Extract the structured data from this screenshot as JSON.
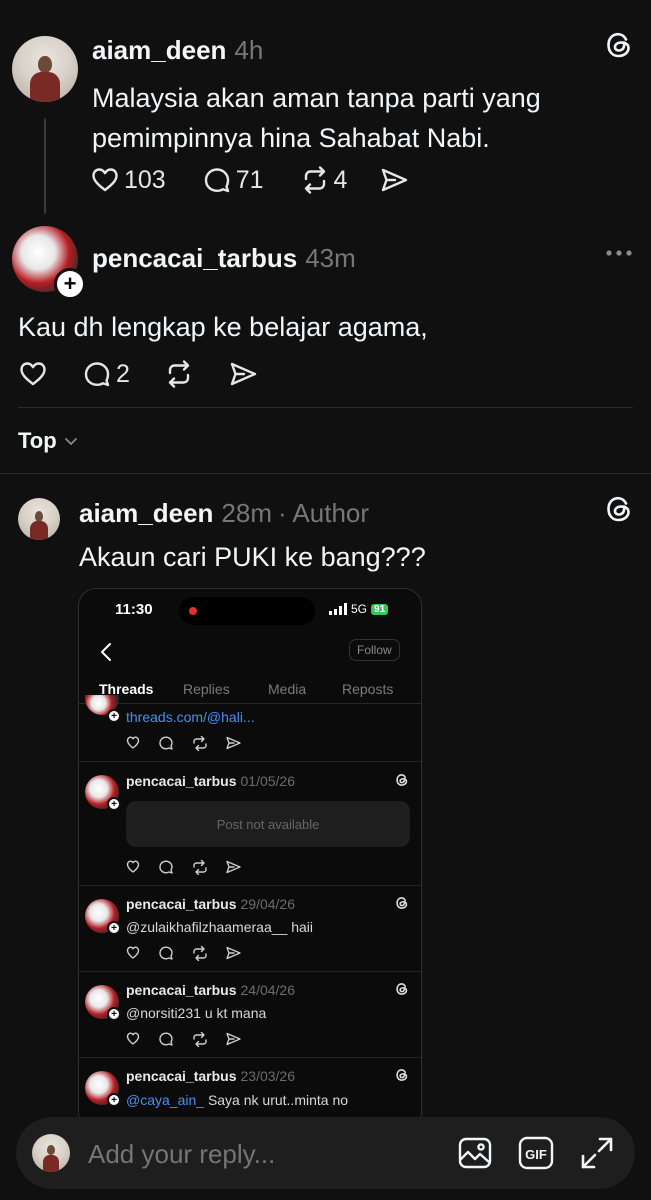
{
  "original_post": {
    "username": "aiam_deen",
    "time": "4h",
    "text_line1": "Malaysia akan aman tanpa parti yang",
    "text_line2": "pemimpinnya hina Sahabat Nabi.",
    "likes": "103",
    "replies": "71",
    "reposts": "4"
  },
  "reply_post": {
    "username": "pencacai_tarbus",
    "time": "43m",
    "text": "Kau dh lengkap ke belajar agama,",
    "replies": "2"
  },
  "sort": {
    "label": "Top"
  },
  "author_reply": {
    "username": "aiam_deen",
    "time": "28m",
    "author_tag": "· Author",
    "text": "Akaun cari PUKI ke bang???"
  },
  "embedded_screenshot": {
    "status_time": "11:30",
    "network": "5G",
    "battery": "91",
    "follow_label": "Follow",
    "tabs": [
      "Threads",
      "Replies",
      "Media",
      "Reposts"
    ],
    "posts": [
      {
        "username": "",
        "date": "",
        "text": "threads.com/@hali..."
      },
      {
        "username": "pencacai_tarbus",
        "date": "01/05/26",
        "text": "Post not available"
      },
      {
        "username": "pencacai_tarbus",
        "date": "29/04/26",
        "mention": "@zulaikhafilzhaameraa__",
        "text": "haii"
      },
      {
        "username": "pencacai_tarbus",
        "date": "24/04/26",
        "mention": "@norsiti231",
        "text": "u kt mana"
      },
      {
        "username": "pencacai_tarbus",
        "date": "23/03/26",
        "mention": "@caya_ain_",
        "text": "Saya nk urut..minta no"
      }
    ]
  },
  "reply_bar": {
    "placeholder": "Add your reply..."
  },
  "icons": [
    "threads-icon",
    "heart-icon",
    "comment-icon",
    "repost-icon",
    "share-icon",
    "more-icon",
    "image-icon",
    "gif-icon",
    "expand-icon",
    "chevron-down-icon",
    "back-icon"
  ],
  "colors": {
    "background": "#101010",
    "text": "#f3f5f7",
    "muted": "#777777",
    "link": "#4a8ef5",
    "record": "#e0322c",
    "battery": "#34c759"
  }
}
